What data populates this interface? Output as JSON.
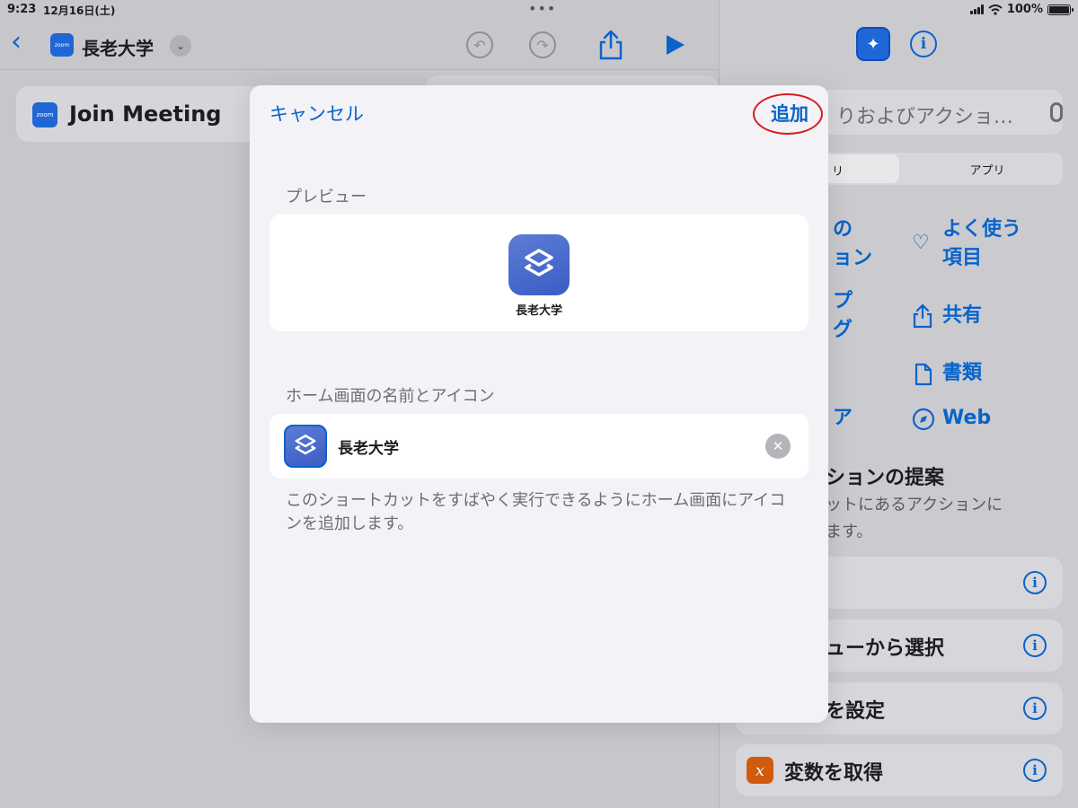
{
  "status": {
    "time": "9:23",
    "date": "12月16日(土)",
    "dots": "•••",
    "battery": "100%",
    "battery_level": 1.0
  },
  "nav": {
    "back_icon": "chevron-left-icon",
    "app_icon_label": "zoom",
    "title": "長老大学",
    "dropdown_icon": "chevron-down-icon",
    "undo_icon": "undo-icon",
    "redo_icon": "redo-icon",
    "share_icon": "share-icon",
    "play_icon": "play-icon"
  },
  "action_card": {
    "icon_label": "zoom",
    "title": "Join Meeting"
  },
  "sidebar": {
    "header_icon": "shortcut-gallery-icon",
    "info_icon": "info-icon",
    "search_text": "りおよびアクショ…",
    "mic_icon": "microphone-icon",
    "segments": [
      "リ",
      "アプリ"
    ],
    "categories": [
      {
        "label_line1": "の",
        "label_line2": "ョン"
      },
      {
        "label_line1": "よく使う",
        "label_line2": "項目",
        "icon": "heart-icon"
      },
      {
        "label_line1": "プ",
        "label_line2": "グ"
      },
      {
        "label_line1": "共有",
        "icon": "share-icon"
      },
      {
        "label_line1": "書類",
        "icon": "document-icon"
      },
      {
        "label_line1": "ア"
      },
      {
        "label_line1": "Web",
        "icon": "safari-compass-icon"
      }
    ],
    "suggest_title": "ションの提案",
    "suggest_sub_line1": "ットにあるアクションに",
    "suggest_sub_line2": "ます。",
    "rows": [
      {
        "label": ""
      },
      {
        "label": "ューから選択"
      },
      {
        "label": "を設定"
      },
      {
        "label": "変数を取得",
        "icon_char": "x"
      }
    ]
  },
  "sheet": {
    "cancel": "キャンセル",
    "add": "追加",
    "preview_label": "プレビュー",
    "preview_name": "長老大学",
    "home_label": "ホーム画面の名前とアイコン",
    "name_value": "長老大学",
    "clear_icon": "clear-icon",
    "note": "このショートカットをすばやく実行できるようにホーム画面にアイコンを追加します。"
  },
  "colors": {
    "accent": "#0a63c9",
    "highlight_ring": "#d81c1c",
    "variable_icon": "#d05b0c"
  }
}
